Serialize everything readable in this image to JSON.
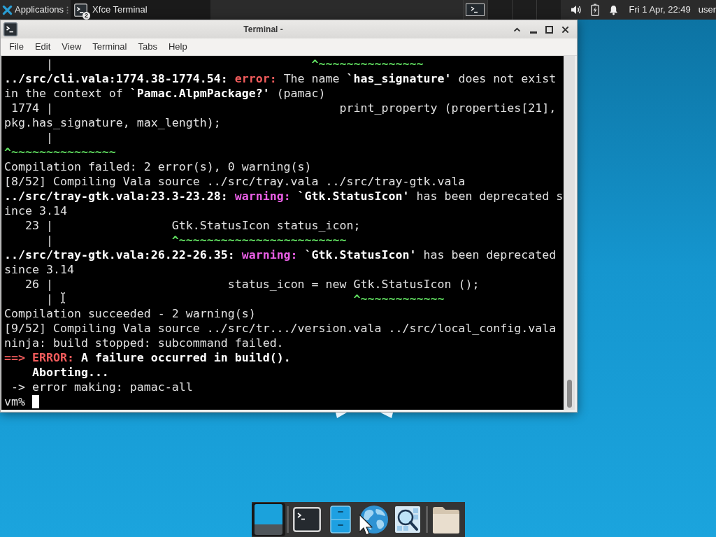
{
  "top_panel": {
    "applications_label": "Applications",
    "taskbar": [
      {
        "title": "Xfce Terminal",
        "badge": "2",
        "selected": true
      }
    ],
    "workspaces": [
      {
        "selected": true,
        "kind": "occupied"
      },
      {
        "selected": false,
        "kind": "empty"
      },
      {
        "selected": false,
        "kind": "empty"
      },
      {
        "selected": false,
        "kind": "empty"
      }
    ],
    "clock": "Fri 1 Apr, 22:49",
    "user": "user"
  },
  "window": {
    "title": "Terminal -",
    "menu": [
      "File",
      "Edit",
      "View",
      "Terminal",
      "Tabs",
      "Help"
    ],
    "terminal": {
      "lines": [
        [
          [
            {
              "kind": "plain",
              "text": "      |"
            }
          ],
          [
            {
              "kind": "caret",
              "text": "                                     ^~~~~~~~~~~~~~~~"
            }
          ]
        ],
        [
          [
            {
              "kind": "bold",
              "text": "../src/cli.vala:1774.38-1774.54:"
            },
            {
              "kind": "error",
              "text": " error:"
            },
            {
              "kind": "plain",
              "text": " The name "
            },
            {
              "kind": "bold",
              "text": "`has_signature'"
            },
            {
              "kind": "plain",
              "text": " does not exist"
            }
          ]
        ],
        [
          [
            {
              "kind": "plain",
              "text": "in the context of "
            },
            {
              "kind": "bold",
              "text": "`Pamac.AlpmPackage?'"
            },
            {
              "kind": "plain",
              "text": " (pamac)"
            }
          ]
        ],
        [
          [
            {
              "kind": "plain",
              "text": " 1774 |"
            }
          ],
          [
            {
              "kind": "plain",
              "text": "                                         print_property (properties[21],"
            }
          ]
        ],
        [
          [
            {
              "kind": "plain",
              "text": "pkg.has_signature, max_length);"
            }
          ]
        ],
        [
          [
            {
              "kind": "plain",
              "text": "      |"
            }
          ]
        ],
        [
          [
            {
              "kind": "caret",
              "text": "^~~~~~~~~~~~~~~~"
            }
          ]
        ],
        [
          [
            {
              "kind": "plain",
              "text": "Compilation failed: 2 error(s), 0 warning(s)"
            }
          ]
        ],
        [
          [
            {
              "kind": "plain",
              "text": "[8/52] Compiling Vala source ../src/tray.vala ../src/tray-gtk.vala"
            }
          ]
        ],
        [
          [
            {
              "kind": "bold",
              "text": "../src/tray-gtk.vala:23.3-23.28:"
            },
            {
              "kind": "warning",
              "text": " warning:"
            },
            {
              "kind": "bold",
              "text": " `Gtk.StatusIcon'"
            },
            {
              "kind": "plain",
              "text": " has been deprecated s"
            }
          ]
        ],
        [
          [
            {
              "kind": "plain",
              "text": "ince 3.14"
            }
          ]
        ],
        [
          [
            {
              "kind": "plain",
              "text": "   23 |"
            }
          ],
          [
            {
              "kind": "plain",
              "text": "                 Gtk.StatusIcon status_icon;"
            }
          ]
        ],
        [
          [
            {
              "kind": "plain",
              "text": "      |"
            }
          ],
          [
            {
              "kind": "caret",
              "text": "                 ^~~~~~~~~~~~~~~~~~~~~~~~~"
            }
          ]
        ],
        [
          [
            {
              "kind": "bold",
              "text": "../src/tray-gtk.vala:26.22-26.35:"
            },
            {
              "kind": "warning",
              "text": " warning:"
            },
            {
              "kind": "bold",
              "text": " `Gtk.StatusIcon'"
            },
            {
              "kind": "plain",
              "text": " has been deprecated"
            }
          ]
        ],
        [
          [
            {
              "kind": "plain",
              "text": "since 3.14"
            }
          ]
        ],
        [
          [
            {
              "kind": "plain",
              "text": "   26 |"
            }
          ],
          [
            {
              "kind": "plain",
              "text": "                         status_icon = new Gtk.StatusIcon ();"
            }
          ]
        ],
        [
          [
            {
              "kind": "plain",
              "text": "      |"
            }
          ],
          [
            {
              "kind": "caret",
              "text": "                                           ^~~~~~~~~~~~~"
            }
          ]
        ],
        [
          [
            {
              "kind": "plain",
              "text": "Compilation succeeded - 2 warning(s)"
            }
          ]
        ],
        [
          [
            {
              "kind": "plain",
              "text": "[9/52] Compiling Vala source ../src/tr.../version.vala ../src/local_config.vala"
            }
          ]
        ],
        [
          [
            {
              "kind": "plain",
              "text": "ninja: build stopped: subcommand failed."
            }
          ]
        ],
        [
          [
            {
              "kind": "error",
              "text": "==>"
            },
            {
              "kind": "error",
              "text": " ERROR:"
            },
            {
              "kind": "bold",
              "text": " A failure occurred in build()."
            }
          ]
        ],
        [
          [
            {
              "kind": "bold",
              "text": "    Aborting..."
            }
          ]
        ],
        [
          [
            {
              "kind": "plain",
              "text": " -> error making: pamac-all"
            }
          ]
        ]
      ],
      "prompt": "vm%",
      "cursor": true
    }
  },
  "dock": {
    "groups": [
      [
        {
          "kind": "show-desktop",
          "selected": true
        }
      ],
      [
        {
          "kind": "terminal",
          "selected": false
        },
        {
          "kind": "file-cabinet",
          "selected": false
        },
        {
          "kind": "web-browser",
          "selected": false
        },
        {
          "kind": "search",
          "selected": false
        }
      ],
      [
        {
          "kind": "folder",
          "selected": false
        }
      ]
    ]
  }
}
